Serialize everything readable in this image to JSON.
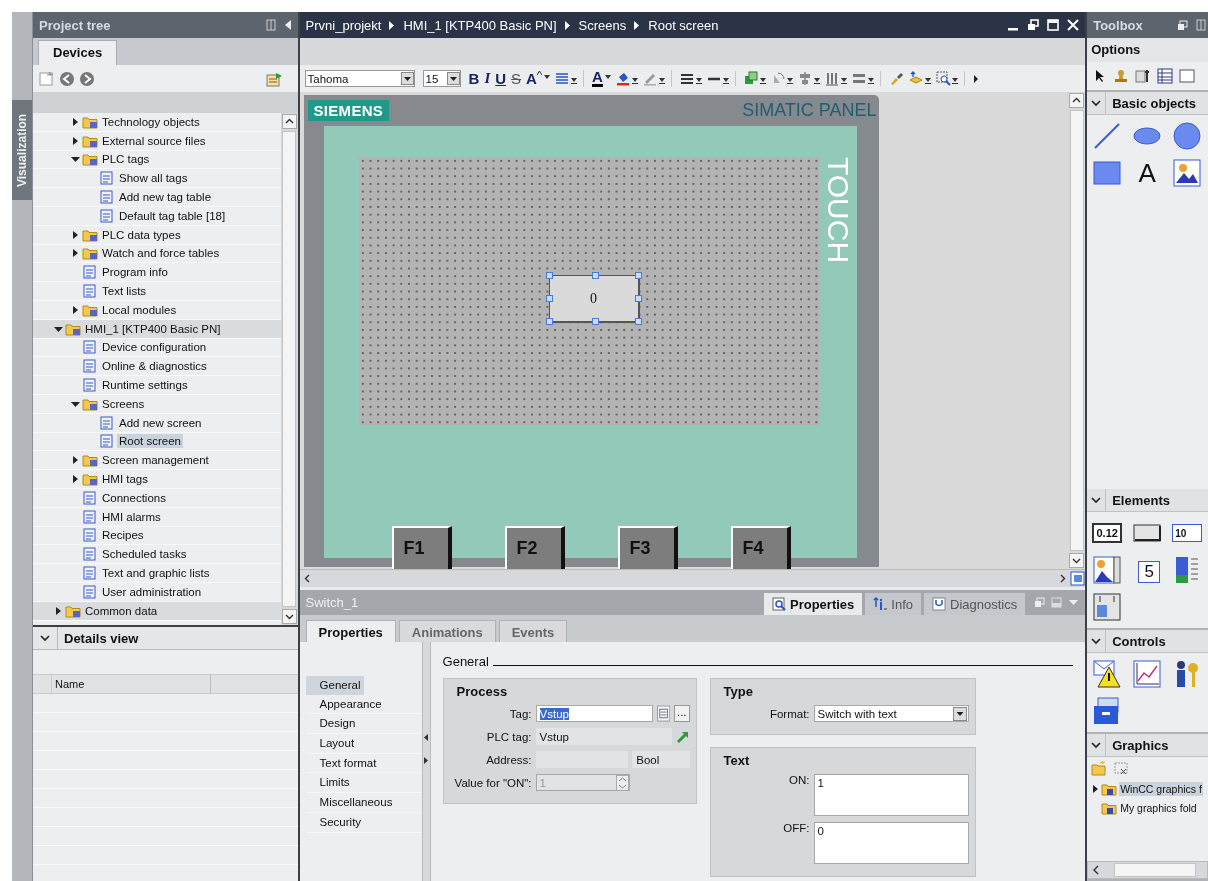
{
  "vertical_tab": {
    "label": "Visualization",
    "selected": true
  },
  "project_tree": {
    "title": "Project tree",
    "tabs": [
      {
        "label": "Devices",
        "selected": true
      }
    ],
    "continued_items": [
      {
        "label": "Technology objects",
        "expanded": false,
        "selected": false
      },
      {
        "label": "External source files",
        "expanded": false,
        "selected": false
      },
      {
        "label": "PLC tags",
        "expanded": true,
        "selected": false,
        "children": [
          {
            "label": "Show all tags",
            "selected": false
          },
          {
            "label": "Add new tag table",
            "selected": false
          },
          {
            "label": "Default tag table [18]",
            "selected": false
          }
        ]
      },
      {
        "label": "PLC data types",
        "expanded": false,
        "selected": false
      },
      {
        "label": "Watch and force tables",
        "expanded": false,
        "selected": false
      },
      {
        "label": "Program info",
        "selected": false
      },
      {
        "label": "Text lists",
        "selected": false
      },
      {
        "label": "Local modules",
        "expanded": false,
        "selected": false
      }
    ],
    "items": [
      {
        "label": "HMI_1 [KTP400 Basic PN]",
        "expanded": true,
        "selected": false,
        "children": [
          {
            "label": "Device configuration",
            "selected": false
          },
          {
            "label": "Online & diagnostics",
            "selected": false
          },
          {
            "label": "Runtime settings",
            "selected": false
          },
          {
            "label": "Screens",
            "expanded": true,
            "selected": false,
            "children": [
              {
                "label": "Add new screen",
                "selected": false
              },
              {
                "label": "Root screen",
                "selected": true
              }
            ]
          },
          {
            "label": "Screen management",
            "expanded": false,
            "selected": false
          },
          {
            "label": "HMI tags",
            "expanded": false,
            "selected": false
          },
          {
            "label": "Connections",
            "selected": false
          },
          {
            "label": "HMI alarms",
            "selected": false
          },
          {
            "label": "Recipes",
            "selected": false
          },
          {
            "label": "Scheduled tasks",
            "selected": false
          },
          {
            "label": "Text and graphic lists",
            "selected": false
          },
          {
            "label": "User administration",
            "selected": false
          }
        ]
      },
      {
        "label": "Common data",
        "expanded": false,
        "selected": false
      }
    ]
  },
  "details_view": {
    "title": "Details view",
    "expanded": true,
    "columns": [
      "Name"
    ]
  },
  "editor": {
    "breadcrumb": [
      "Prvni_projekt",
      "HMI_1 [KTP400 Basic PN]",
      "Screens",
      "Root screen"
    ],
    "toolbar": {
      "font": "Tahoma",
      "size": "15",
      "groups": [
        [
          {
            "kind": "bold",
            "glyph": "B"
          },
          {
            "kind": "italic",
            "glyph": "I"
          },
          {
            "kind": "underline",
            "glyph": "U"
          },
          {
            "kind": "strike",
            "glyph": "S"
          },
          {
            "kind": "size",
            "glyph": "A"
          },
          {
            "kind": "align"
          }
        ],
        [
          {
            "kind": "color",
            "glyph": "A"
          },
          {
            "kind": "fill"
          },
          {
            "kind": "pen"
          }
        ],
        [
          {
            "kind": "linestyle"
          },
          {
            "kind": "linewidth"
          }
        ],
        [
          {
            "kind": "order"
          },
          {
            "kind": "rotate"
          },
          {
            "kind": "alignobj"
          },
          {
            "kind": "distribute"
          },
          {
            "kind": "samesize"
          }
        ],
        [
          {
            "kind": "brush"
          },
          {
            "kind": "layer"
          },
          {
            "kind": "zoom"
          }
        ]
      ]
    },
    "panel": {
      "brand": "SIEMENS",
      "model": "SIMATIC PANEL",
      "side_label": "TOUCH",
      "screen_object": {
        "text": "0",
        "selected": true
      },
      "keys": [
        "F1",
        "F2",
        "F3",
        "F4"
      ]
    }
  },
  "inspector": {
    "object": "Switch_1",
    "view_tabs": [
      {
        "label": "Properties",
        "selected": true
      },
      {
        "label": "Info",
        "selected": false
      },
      {
        "label": "Diagnostics",
        "selected": false
      }
    ],
    "tabs": [
      {
        "label": "Properties",
        "selected": true
      },
      {
        "label": "Animations",
        "selected": false
      },
      {
        "label": "Events",
        "selected": false
      }
    ],
    "nav": [
      {
        "label": "General",
        "selected": true
      },
      {
        "label": "Appearance",
        "selected": false
      },
      {
        "label": "Design",
        "selected": false
      },
      {
        "label": "Layout",
        "selected": false
      },
      {
        "label": "Text format",
        "selected": false
      },
      {
        "label": "Limits",
        "selected": false
      },
      {
        "label": "Miscellaneous",
        "selected": false
      },
      {
        "label": "Security",
        "selected": false
      }
    ],
    "section": "General",
    "process": {
      "title": "Process",
      "tag_label": "Tag:",
      "tag": "Vstup",
      "tag_text_selected": true,
      "browse": "...",
      "plc_tag_label": "PLC tag:",
      "plc_tag": "Vstup",
      "address_label": "Address:",
      "data_type": "Bool",
      "on_value_label": "Value for \"ON\":",
      "on_value": "1",
      "on_value_disabled": true
    },
    "type": {
      "title": "Type",
      "format_label": "Format:",
      "format": "Switch with text"
    },
    "text": {
      "title": "Text",
      "on_label": "ON:",
      "on": "1",
      "off_label": "OFF:",
      "off": "0"
    }
  },
  "toolbox": {
    "title": "Toolbox",
    "options_title": "Options",
    "sections": [
      {
        "title": "Basic objects",
        "expanded": true,
        "items": [
          {
            "kind": "line"
          },
          {
            "kind": "ellipse"
          },
          {
            "kind": "circle"
          },
          {
            "kind": "rectangle"
          },
          {
            "kind": "text",
            "glyph": "A"
          },
          {
            "kind": "image"
          }
        ]
      },
      {
        "title": "Elements",
        "expanded": true,
        "items": [
          {
            "kind": "io-field",
            "glyph": "0.12"
          },
          {
            "kind": "button"
          },
          {
            "kind": "symbolic",
            "glyph": "10"
          },
          {
            "kind": "graphic-io"
          },
          {
            "kind": "clock",
            "glyph": "5"
          },
          {
            "kind": "bar"
          },
          {
            "kind": "switch"
          }
        ]
      },
      {
        "title": "Controls",
        "expanded": true,
        "items": [
          {
            "kind": "alarm"
          },
          {
            "kind": "trend"
          },
          {
            "kind": "user"
          },
          {
            "kind": "recipe"
          }
        ]
      },
      {
        "title": "Graphics",
        "expanded": true,
        "folders": [
          {
            "label": "WinCC graphics f",
            "expanded": false,
            "selected": true
          },
          {
            "label": "My graphics fold",
            "selected": false
          }
        ]
      }
    ]
  }
}
